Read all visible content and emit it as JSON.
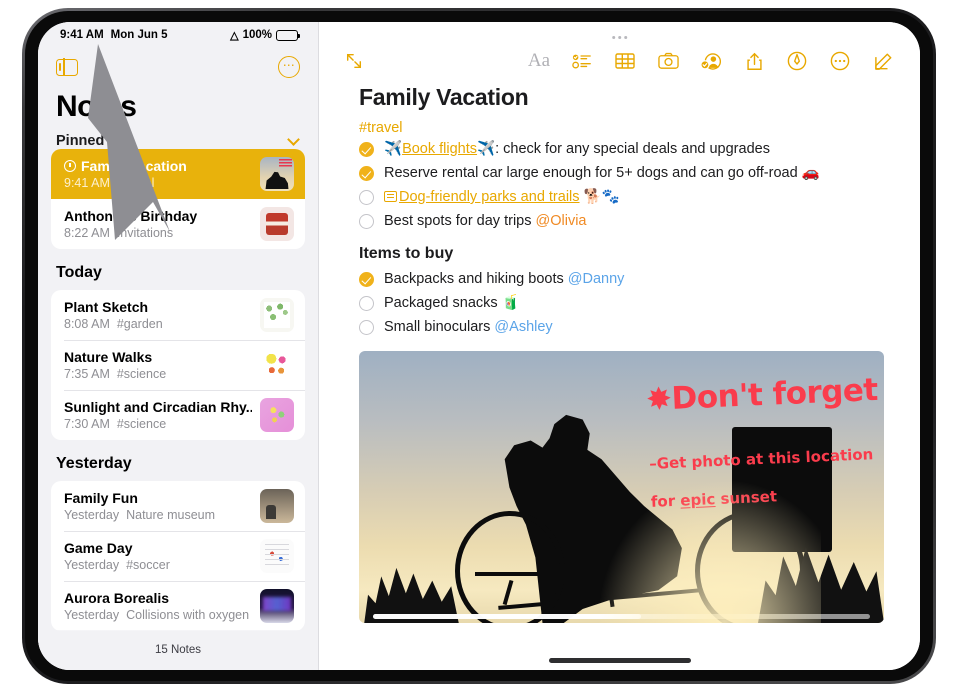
{
  "status_bar": {
    "time": "9:41 AM",
    "date": "Mon Jun 5",
    "wifi_icon": "wifi-icon",
    "battery_percent": "100%"
  },
  "sidebar": {
    "toggle_icon": "sidebar-toggle-icon",
    "more_icon": "more-circle-icon",
    "title": "Notes",
    "pinned_header": {
      "label": "Pinned",
      "chevron_icon": "chevron-down-icon"
    },
    "footer_count": "15 Notes",
    "sections": [
      {
        "label": "",
        "notes": [
          {
            "title": "Family Vacation",
            "time": "9:41 AM",
            "preview": "#travel",
            "selected": true,
            "pinned": true,
            "thumb": "th-cyclist"
          },
          {
            "title": "Anthonio's Birthday",
            "time": "8:22 AM",
            "preview": "Invitations",
            "selected": false,
            "pinned": false,
            "thumb": "th-cake"
          }
        ]
      },
      {
        "label": "Today",
        "notes": [
          {
            "title": "Plant Sketch",
            "time": "8:08 AM",
            "preview": "#garden",
            "selected": false,
            "pinned": false,
            "thumb": "th-plant"
          },
          {
            "title": "Nature Walks",
            "time": "7:35 AM",
            "preview": "#science",
            "selected": false,
            "pinned": false,
            "thumb": "th-nature"
          },
          {
            "title": "Sunlight and Circadian Rhy...",
            "time": "7:30 AM",
            "preview": "#science",
            "selected": false,
            "pinned": false,
            "thumb": "th-sun"
          }
        ]
      },
      {
        "label": "Yesterday",
        "notes": [
          {
            "title": "Family Fun",
            "time": "Yesterday",
            "preview": "Nature museum",
            "selected": false,
            "pinned": false,
            "thumb": "th-family"
          },
          {
            "title": "Game Day",
            "time": "Yesterday",
            "preview": "#soccer",
            "selected": false,
            "pinned": false,
            "thumb": "th-game"
          },
          {
            "title": "Aurora Borealis",
            "time": "Yesterday",
            "preview": "Collisions with oxygen",
            "selected": false,
            "pinned": false,
            "thumb": "th-aurora"
          }
        ]
      }
    ]
  },
  "toolbar": {
    "expand_icon": "expand-arrows-icon",
    "drag_handle_icon": "drag-handle-ellipsis-icon",
    "format_label": "Aa",
    "checklist_icon": "checklist-icon",
    "table_icon": "table-icon",
    "camera_icon": "camera-icon",
    "collaborate_icon": "add-person-icon",
    "share_icon": "share-icon",
    "markup_icon": "markup-pen-icon",
    "more_icon": "more-circle-icon",
    "compose_icon": "compose-icon"
  },
  "note": {
    "title": "Family Vacation",
    "tag": "#travel",
    "checklist": [
      {
        "checked": true,
        "emoji_before": "✈️",
        "link": "Book flights",
        "emoji_after": "✈️",
        "text": ": check for any special deals and upgrades",
        "mention": "",
        "trailing_emoji": ""
      },
      {
        "checked": true,
        "emoji_before": "",
        "link": "",
        "emoji_after": "",
        "text": "Reserve rental car large enough for 5+ dogs and can go off-road",
        "mention": "",
        "trailing_emoji": "🚗"
      },
      {
        "checked": false,
        "emoji_before": "",
        "link": "Dog-friendly parks and trails",
        "emoji_after": "",
        "text": "",
        "mention": "",
        "trailing_emoji": "🐕🐾"
      },
      {
        "checked": false,
        "emoji_before": "",
        "link": "",
        "emoji_after": "",
        "text": "Best spots for day trips",
        "mention": "@Olivia",
        "mention_color": "orange",
        "trailing_emoji": ""
      }
    ],
    "section_heading": "Items to buy",
    "buy_list": [
      {
        "checked": true,
        "text": "Backpacks and hiking boots",
        "mention": "@Danny",
        "mention_color": "blue",
        "trailing_emoji": ""
      },
      {
        "checked": false,
        "text": "Packaged snacks",
        "mention": "",
        "trailing_emoji": "🧃"
      },
      {
        "checked": false,
        "text": "Small binoculars",
        "mention": "@Ashley",
        "mention_color": "blue",
        "trailing_emoji": ""
      }
    ],
    "photo": {
      "description": "cyclist silhouette at sunset",
      "handwriting_title": "✸Don't forget",
      "handwriting_body_line1": "–Get photo at this location",
      "handwriting_body_line2_pre": "for ",
      "handwriting_body_line2_underlined": "epic",
      "handwriting_body_line2_post": " sunset",
      "handwriting_color": "#FA3C4C"
    }
  },
  "colors": {
    "accent": "#E8A800",
    "selected_row": "#E8B20C",
    "mention_blue": "#5BA4E8",
    "mention_orange": "#F08A24"
  },
  "cursor": {
    "icon": "mouse-pointer-arrow",
    "color": "#8E8E93"
  }
}
